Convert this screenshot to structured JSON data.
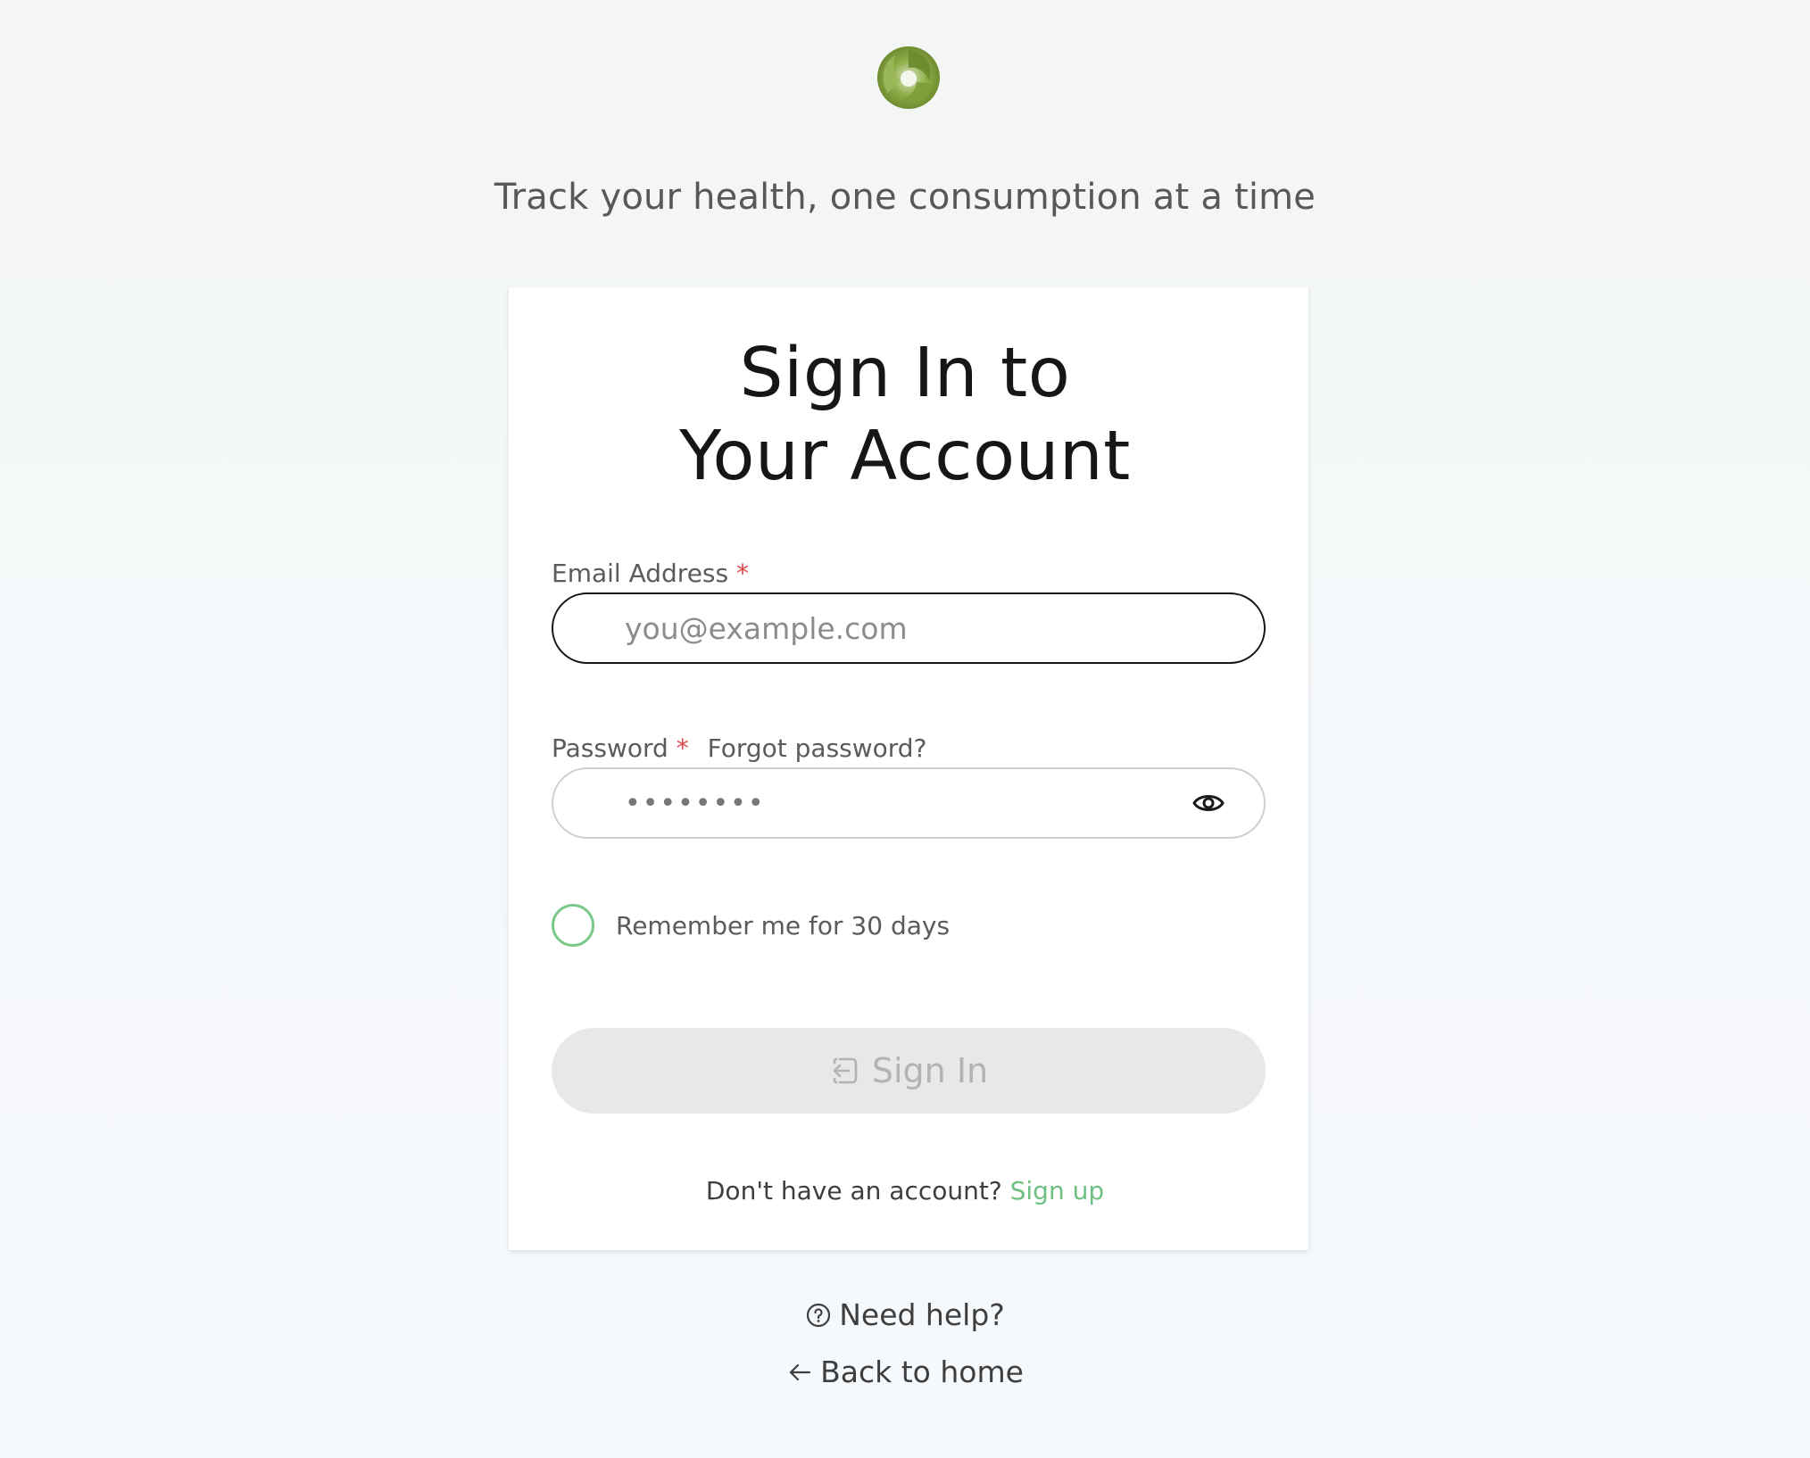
{
  "brand": {
    "logo_icon": "swirl-logo-icon",
    "logo_color": "#7a9a3a",
    "tagline": "Track your health, one consumption at a time"
  },
  "form": {
    "title": "Sign In to Your Account",
    "email": {
      "label": "Email Address",
      "required_marker": "*",
      "placeholder": "you@example.com",
      "value": ""
    },
    "password": {
      "label": "Password",
      "required_marker": "*",
      "forgot_label": "Forgot password?",
      "value": "password",
      "toggle_icon": "eye-icon"
    },
    "remember": {
      "label": "Remember me for 30 days",
      "checked": false
    },
    "submit": {
      "label": "Sign In",
      "icon": "sign-in-icon",
      "disabled": true
    },
    "signup_prompt": "Don't have an account?",
    "signup_link": "Sign up"
  },
  "footer": {
    "help_label": "Need help?",
    "help_icon": "help-circle-icon",
    "back_label": "Back to home",
    "back_icon": "arrow-left-icon"
  },
  "colors": {
    "accent_green": "#6dbf82",
    "required_red": "#e0474c",
    "disabled_button_bg": "#e8e8e8"
  }
}
